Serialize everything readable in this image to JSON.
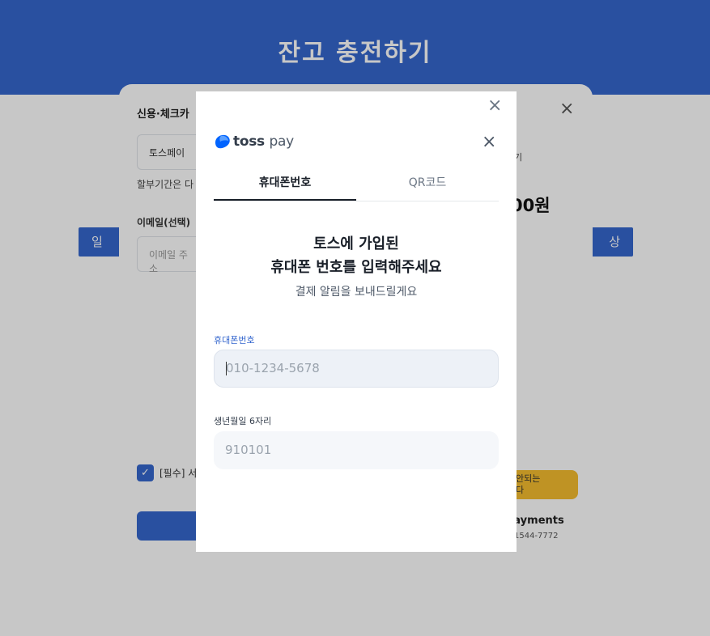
{
  "background": {
    "page_title": "잔고 충전하기",
    "left_button_label": "일반 결",
    "right_button_label": "상품권",
    "checkout": {
      "section_title": "신용·체크카",
      "selected_method": "토스페이",
      "installment_note": "할부기간은 다",
      "email_label": "이메일(선택)",
      "email_placeholder": "이메일 주소",
      "agree_label": "[필수] 서",
      "close_icon": "×",
      "side_note": "기",
      "amount": "00원",
      "warning_text": "안되는\n다",
      "brand": "payments",
      "phone": "1544-7772",
      "check_glyph": "✓"
    }
  },
  "modal": {
    "outer_close_icon": "×",
    "logo_text": "toss",
    "logo_pay": "pay",
    "inner_close_icon": "×",
    "tabs": [
      {
        "label": "휴대폰번호",
        "active": true
      },
      {
        "label": "QR코드",
        "active": false
      }
    ],
    "heading_line1": "토스에 가입된",
    "heading_line2": "휴대폰 번호를 입력해주세요",
    "subheading": "결제 알림을 보내드릴게요",
    "phone_field": {
      "label": "휴대폰번호",
      "placeholder": "010-1234-5678",
      "value": ""
    },
    "birth_field": {
      "label": "생년월일 6자리",
      "placeholder": "910101",
      "value": ""
    },
    "colors": {
      "accent": "#3567ce",
      "logo_blue": "#0064ff"
    }
  }
}
